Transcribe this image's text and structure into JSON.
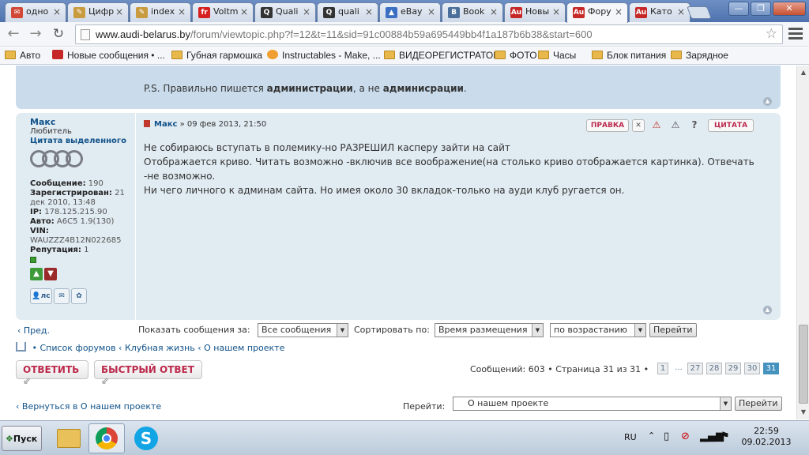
{
  "browser": {
    "tabs": [
      {
        "label": "одно",
        "icon": "gmail-icon",
        "color": "#d14836",
        "glyph": "✉"
      },
      {
        "label": "Цифр",
        "icon": "pencil-icon",
        "color": "#c99b3f",
        "glyph": "✎"
      },
      {
        "label": "index",
        "icon": "pencil-icon",
        "color": "#c99b3f",
        "glyph": "✎"
      },
      {
        "label": "Voltm",
        "icon": "free-icon",
        "color": "#d62020",
        "glyph": "free"
      },
      {
        "label": "Quali",
        "icon": "quora-icon",
        "color": "#333333",
        "glyph": "Q"
      },
      {
        "label": "quali",
        "icon": "quora-icon",
        "color": "#333333",
        "glyph": "Q"
      },
      {
        "label": "eBay",
        "icon": "ebay-icon",
        "color": "#3b6fc3",
        "glyph": "▲"
      },
      {
        "label": "Book",
        "icon": "vk-icon",
        "color": "#4a6f9a",
        "glyph": "B"
      },
      {
        "label": "Новы",
        "icon": "audi-icon",
        "color": "#c62828",
        "glyph": "Audi"
      },
      {
        "label": "Фору",
        "icon": "audi-icon",
        "color": "#c62828",
        "glyph": "Audi",
        "active": true
      },
      {
        "label": "Като",
        "icon": "audi-icon",
        "color": "#c62828",
        "glyph": "Audi"
      }
    ],
    "url_host": "www.audi-belarus.by",
    "url_path": "/forum/viewtopic.php?f=12&t=11&sid=91c00884b59a695449bb4f1a187b6b38&start=600",
    "bookmarks": [
      {
        "label": "Авто",
        "type": "folder"
      },
      {
        "label": "Новые сообщения • ...",
        "type": "audi"
      },
      {
        "label": "Губная гармошка",
        "type": "folder"
      },
      {
        "label": "Instructables - Make, ...",
        "type": "instructables"
      },
      {
        "label": "ВИДЕОРЕГИСТРАТОР",
        "type": "folder"
      },
      {
        "label": "ФОТО",
        "type": "folder"
      },
      {
        "label": "Часы",
        "type": "folder"
      },
      {
        "label": "Блок питания",
        "type": "folder"
      },
      {
        "label": "Зарядное",
        "type": "folder"
      }
    ]
  },
  "prev_post": {
    "text_prefix": "P.S. Правильно пишется ",
    "word1": "администрации",
    "text_mid": ", а не ",
    "word2": "админисрации",
    "text_suffix": "."
  },
  "post": {
    "author": "Макс",
    "rank": "Любитель",
    "quote_label": "Цитата выделенного",
    "messages_label": "Сообщение:",
    "messages": "190",
    "registered_label": "Зарегистрирован:",
    "registered": "21 дек 2010, 13:48",
    "ip_label": "IP:",
    "ip": "178.125.215.90",
    "auto_label": "Авто:",
    "auto": "A6C5 1.9(130)",
    "vin_label": "VIN:",
    "vin": "WAUZZZ4B12N022685",
    "rep_label": "Репутация:",
    "rep": "1",
    "pm_label": "лс",
    "head_author": "Макс",
    "head_date": " » 09 фев 2013, 21:50",
    "edit_label": "ПРАВКА",
    "quote_btn_label": "ЦИТАТА",
    "body": "Не собираюсь вступать в полемику-но РАЗРЕШИЛ касперу зайти на сайт\nОтображается криво. Читать возможно -включив все воображение(на столько криво отображается картинка). Отвечать -не возможно.\nНи чего личного к админам сайта. Но имея около 30 вкладок-только на ауди клуб ругается он."
  },
  "controls": {
    "prev": "Пред.",
    "show_label": "Показать сообщения за:",
    "show_value": "Все сообщения",
    "sort_label": "Сортировать по:",
    "sort_value": "Время размещения",
    "order_value": "по возрастанию",
    "go": "Перейти"
  },
  "crumbs": {
    "forum_list": "Список форумов",
    "club": "Клубная жизнь",
    "about": "О нашем проекте"
  },
  "actions": {
    "reply": "ОТВЕТИТЬ",
    "quick_reply": "БЫСТРЫЙ ОТВЕТ",
    "pagination_text": "Сообщений: 603 • Страница 31 из 31 •",
    "pages": [
      "1",
      "...",
      "27",
      "28",
      "29",
      "30",
      "31"
    ],
    "current_page": "31"
  },
  "bottom": {
    "back": "Вернуться в О нашем проекте",
    "jump_label": "Перейти:",
    "jump_value": "О нашем проекте",
    "go": "Перейти"
  },
  "taskbar": {
    "start": "Пуск",
    "lang": "RU",
    "time": "22:59",
    "date": "09.02.2013"
  }
}
